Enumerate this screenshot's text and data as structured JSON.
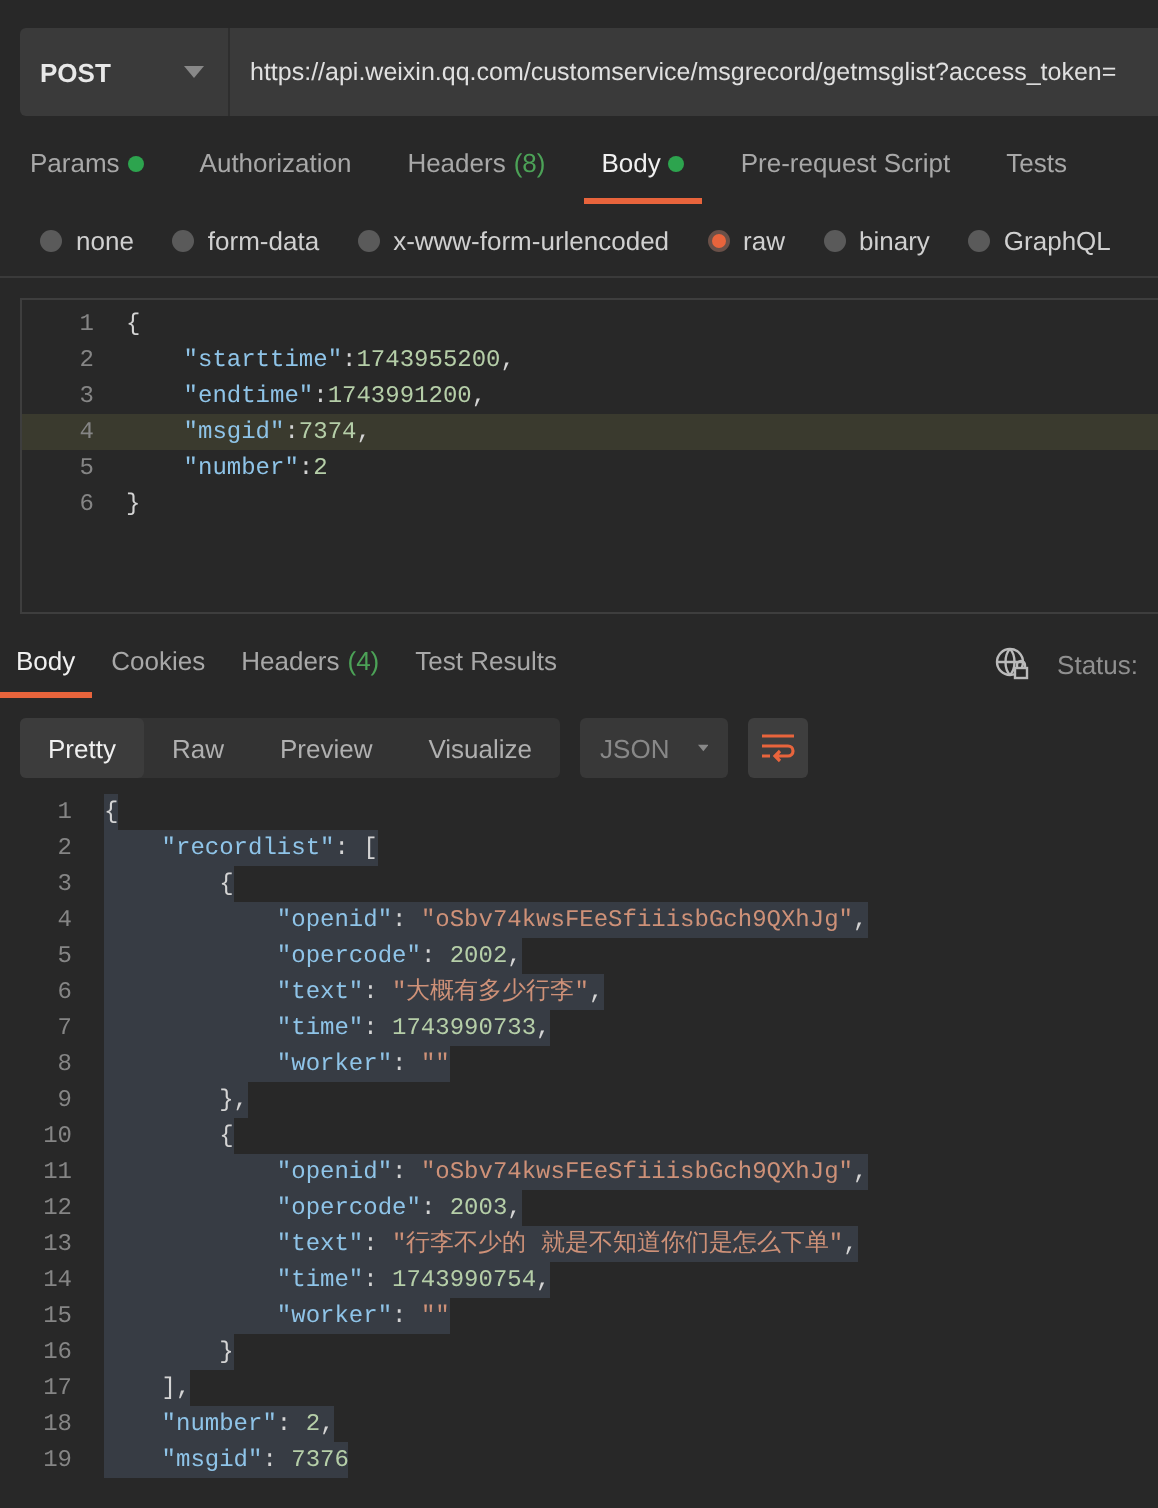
{
  "request": {
    "method": "POST",
    "url": "https://api.weixin.qq.com/customservice/msgrecord/getmsglist?access_token="
  },
  "request_tabs": [
    {
      "label": "Params",
      "dot": true,
      "selected": false
    },
    {
      "label": "Authorization",
      "dot": false,
      "selected": false
    },
    {
      "label": "Headers",
      "count": "(8)",
      "dot": false,
      "selected": false
    },
    {
      "label": "Body",
      "dot": true,
      "selected": true
    },
    {
      "label": "Pre-request Script",
      "dot": false,
      "selected": false
    },
    {
      "label": "Tests",
      "dot": false,
      "selected": false
    }
  ],
  "body_types": [
    {
      "label": "none",
      "selected": false
    },
    {
      "label": "form-data",
      "selected": false
    },
    {
      "label": "x-www-form-urlencoded",
      "selected": false
    },
    {
      "label": "raw",
      "selected": true
    },
    {
      "label": "binary",
      "selected": false
    },
    {
      "label": "GraphQL",
      "selected": false
    }
  ],
  "request_body": {
    "lines": [
      {
        "number": "1",
        "highlighted": false,
        "tokens": [
          {
            "kind": "punct",
            "text": "{"
          }
        ]
      },
      {
        "number": "2",
        "highlighted": false,
        "tokens": [
          {
            "kind": "key",
            "text": "    \"starttime\""
          },
          {
            "kind": "punct",
            "text": ":"
          },
          {
            "kind": "num",
            "text": "1743955200"
          },
          {
            "kind": "punct",
            "text": ","
          }
        ]
      },
      {
        "number": "3",
        "highlighted": false,
        "tokens": [
          {
            "kind": "key",
            "text": "    \"endtime\""
          },
          {
            "kind": "punct",
            "text": ":"
          },
          {
            "kind": "num",
            "text": "1743991200"
          },
          {
            "kind": "punct",
            "text": ","
          }
        ]
      },
      {
        "number": "4",
        "highlighted": true,
        "tokens": [
          {
            "kind": "key",
            "text": "    \"msgid\""
          },
          {
            "kind": "punct",
            "text": ":"
          },
          {
            "kind": "num",
            "text": "7374"
          },
          {
            "kind": "punct",
            "text": ","
          }
        ]
      },
      {
        "number": "5",
        "highlighted": false,
        "tokens": [
          {
            "kind": "key",
            "text": "    \"number\""
          },
          {
            "kind": "punct",
            "text": ":"
          },
          {
            "kind": "num",
            "text": "2"
          }
        ]
      },
      {
        "number": "6",
        "highlighted": false,
        "tokens": [
          {
            "kind": "punct",
            "text": "}"
          }
        ]
      }
    ]
  },
  "response_tabs": [
    {
      "label": "Body",
      "selected": true
    },
    {
      "label": "Cookies",
      "selected": false
    },
    {
      "label": "Headers",
      "count": "(4)",
      "selected": false
    },
    {
      "label": "Test Results",
      "selected": false
    }
  ],
  "status_label": "Status:",
  "view_modes": [
    {
      "label": "Pretty",
      "selected": true
    },
    {
      "label": "Raw",
      "selected": false
    },
    {
      "label": "Preview",
      "selected": false
    },
    {
      "label": "Visualize",
      "selected": false
    }
  ],
  "format": "JSON",
  "wrap_lines": {
    "on": true
  },
  "response_body": {
    "lines": [
      {
        "number": "1",
        "selected": true,
        "tokens": [
          {
            "kind": "punct",
            "text": "{"
          }
        ]
      },
      {
        "number": "2",
        "selected": true,
        "tokens": [
          {
            "kind": "key",
            "text": "    \"recordlist\""
          },
          {
            "kind": "punct",
            "text": ": ["
          }
        ]
      },
      {
        "number": "3",
        "selected": true,
        "tokens": [
          {
            "kind": "punct",
            "text": "        {"
          }
        ]
      },
      {
        "number": "4",
        "selected": true,
        "tokens": [
          {
            "kind": "key",
            "text": "            \"openid\""
          },
          {
            "kind": "punct",
            "text": ": "
          },
          {
            "kind": "str",
            "text": "\"oSbv74kwsFEeSfiiisbGch9QXhJg\""
          },
          {
            "kind": "punct",
            "text": ","
          }
        ]
      },
      {
        "number": "5",
        "selected": true,
        "tokens": [
          {
            "kind": "key",
            "text": "            \"opercode\""
          },
          {
            "kind": "punct",
            "text": ": "
          },
          {
            "kind": "num",
            "text": "2002"
          },
          {
            "kind": "punct",
            "text": ","
          }
        ]
      },
      {
        "number": "6",
        "selected": true,
        "tokens": [
          {
            "kind": "key",
            "text": "            \"text\""
          },
          {
            "kind": "punct",
            "text": ": "
          },
          {
            "kind": "str",
            "text": "\"大概有多少行李\""
          },
          {
            "kind": "punct",
            "text": ","
          }
        ]
      },
      {
        "number": "7",
        "selected": true,
        "tokens": [
          {
            "kind": "key",
            "text": "            \"time\""
          },
          {
            "kind": "punct",
            "text": ": "
          },
          {
            "kind": "num",
            "text": "1743990733"
          },
          {
            "kind": "punct",
            "text": ","
          }
        ]
      },
      {
        "number": "8",
        "selected": true,
        "tokens": [
          {
            "kind": "key",
            "text": "            \"worker\""
          },
          {
            "kind": "punct",
            "text": ": "
          },
          {
            "kind": "str",
            "text": "\"\""
          }
        ]
      },
      {
        "number": "9",
        "selected": true,
        "tokens": [
          {
            "kind": "punct",
            "text": "        },"
          }
        ]
      },
      {
        "number": "10",
        "selected": true,
        "tokens": [
          {
            "kind": "punct",
            "text": "        {"
          }
        ]
      },
      {
        "number": "11",
        "selected": true,
        "tokens": [
          {
            "kind": "key",
            "text": "            \"openid\""
          },
          {
            "kind": "punct",
            "text": ": "
          },
          {
            "kind": "str",
            "text": "\"oSbv74kwsFEeSfiiisbGch9QXhJg\""
          },
          {
            "kind": "punct",
            "text": ","
          }
        ]
      },
      {
        "number": "12",
        "selected": true,
        "tokens": [
          {
            "kind": "key",
            "text": "            \"opercode\""
          },
          {
            "kind": "punct",
            "text": ": "
          },
          {
            "kind": "num",
            "text": "2003"
          },
          {
            "kind": "punct",
            "text": ","
          }
        ]
      },
      {
        "number": "13",
        "selected": true,
        "tokens": [
          {
            "kind": "key",
            "text": "            \"text\""
          },
          {
            "kind": "punct",
            "text": ": "
          },
          {
            "kind": "str",
            "text": "\"行李不少的 就是不知道你们是怎么下单\""
          },
          {
            "kind": "punct",
            "text": ","
          }
        ]
      },
      {
        "number": "14",
        "selected": true,
        "tokens": [
          {
            "kind": "key",
            "text": "            \"time\""
          },
          {
            "kind": "punct",
            "text": ": "
          },
          {
            "kind": "num",
            "text": "1743990754"
          },
          {
            "kind": "punct",
            "text": ","
          }
        ]
      },
      {
        "number": "15",
        "selected": true,
        "tokens": [
          {
            "kind": "key",
            "text": "            \"worker\""
          },
          {
            "kind": "punct",
            "text": ": "
          },
          {
            "kind": "str",
            "text": "\"\""
          }
        ]
      },
      {
        "number": "16",
        "selected": true,
        "tokens": [
          {
            "kind": "punct",
            "text": "        }"
          }
        ]
      },
      {
        "number": "17",
        "selected": true,
        "tokens": [
          {
            "kind": "punct",
            "text": "    ],"
          }
        ]
      },
      {
        "number": "18",
        "selected": true,
        "tokens": [
          {
            "kind": "key",
            "text": "    \"number\""
          },
          {
            "kind": "punct",
            "text": ": "
          },
          {
            "kind": "num",
            "text": "2"
          },
          {
            "kind": "punct",
            "text": ","
          }
        ]
      },
      {
        "number": "19",
        "selected": true,
        "tokens": [
          {
            "kind": "key",
            "text": "    \"msgid\""
          },
          {
            "kind": "punct",
            "text": ": "
          },
          {
            "kind": "num",
            "text": "7376"
          }
        ]
      }
    ]
  }
}
